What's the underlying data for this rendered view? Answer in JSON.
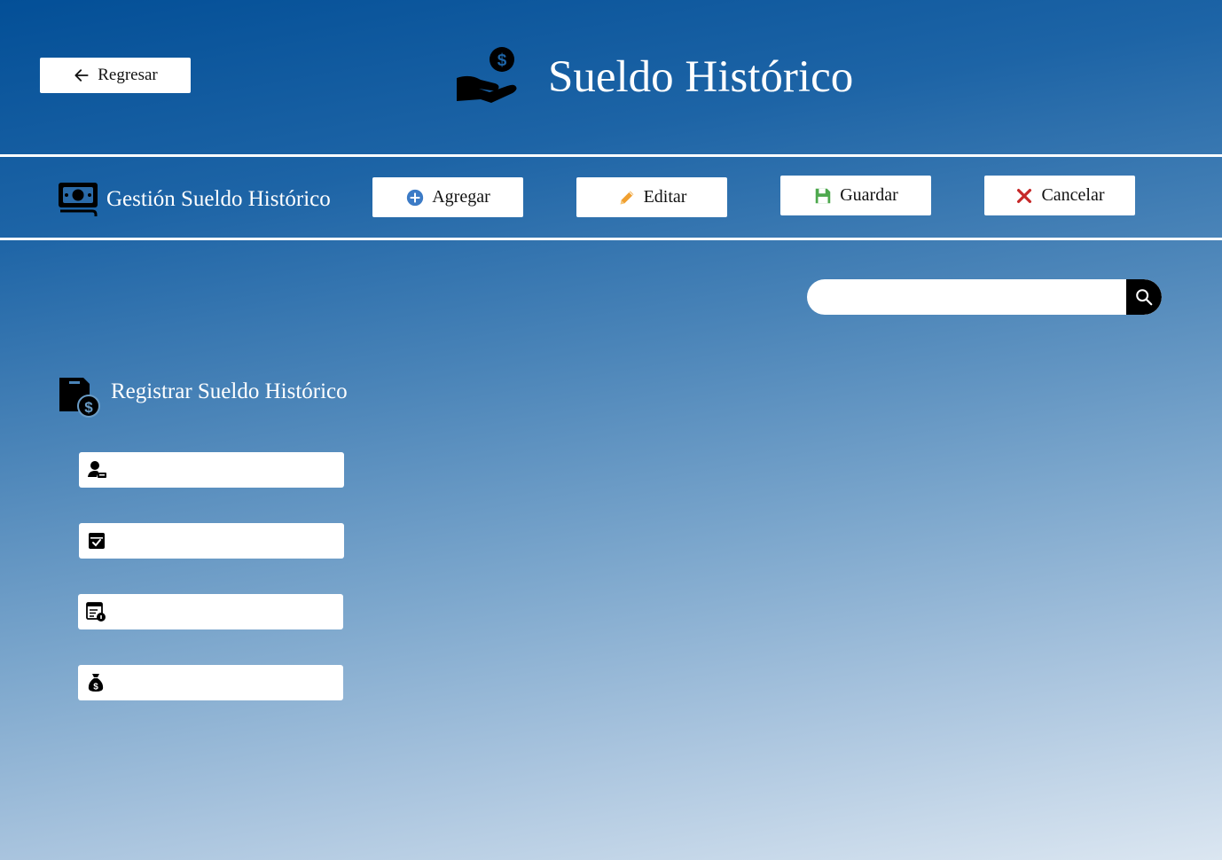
{
  "header": {
    "back_label": "Regresar",
    "title": "Sueldo Histórico",
    "icons": {
      "back": "arrow-left-icon",
      "title": "hand-dollar-icon"
    }
  },
  "toolbar": {
    "title": "Gestión Sueldo Histórico",
    "icon": "money-bill-icon",
    "buttons": {
      "add": {
        "label": "Agregar",
        "icon": "plus-circle-icon",
        "color": "#3c7bc6"
      },
      "edit": {
        "label": "Editar",
        "icon": "pencil-icon",
        "color": "#f0a030"
      },
      "save": {
        "label": "Guardar",
        "icon": "floppy-disk-icon",
        "color": "#4ea84e"
      },
      "cancel": {
        "label": "Cancelar",
        "icon": "x-mark-icon",
        "color": "#c62828"
      }
    }
  },
  "search": {
    "placeholder": "",
    "value": "",
    "icon": "magnifier-icon"
  },
  "form": {
    "title": "Registrar Sueldo  Histórico",
    "icon": "file-dollar-icon",
    "fields": [
      {
        "name": "employee",
        "icon": "person-icon",
        "value": ""
      },
      {
        "name": "date",
        "icon": "calendar-check-icon",
        "value": ""
      },
      {
        "name": "details",
        "icon": "list-info-icon",
        "value": ""
      },
      {
        "name": "amount",
        "icon": "money-bag-icon",
        "value": ""
      }
    ]
  }
}
